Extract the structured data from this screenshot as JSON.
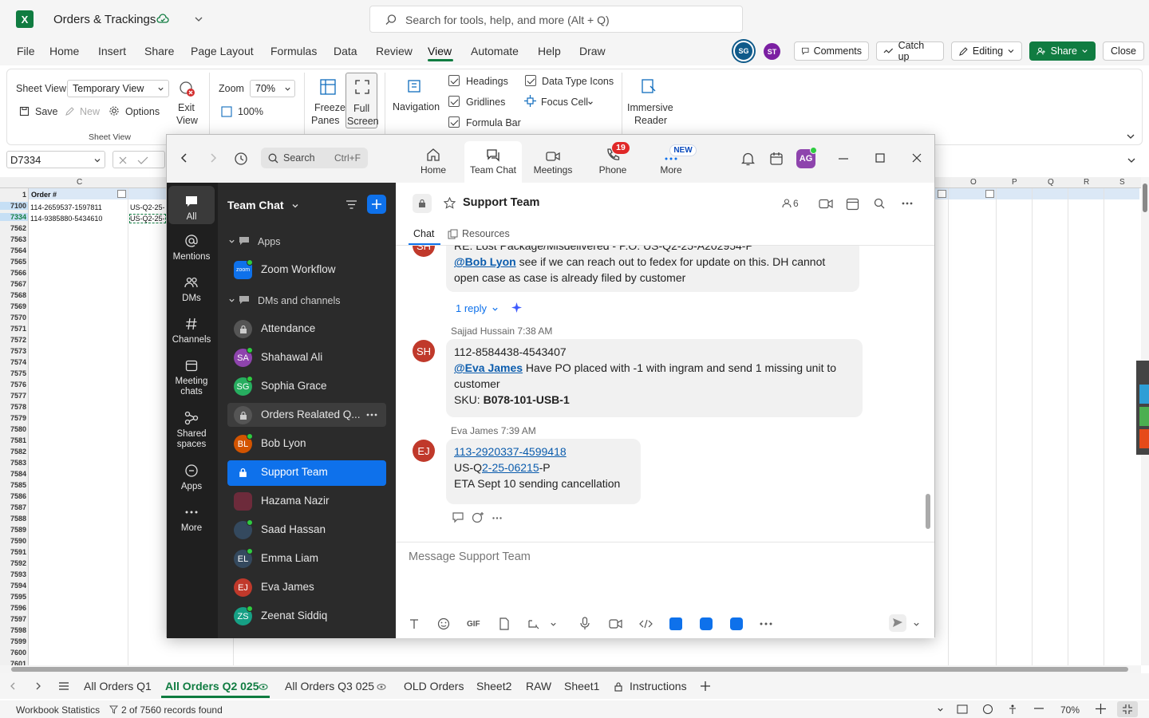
{
  "excel": {
    "title": "Orders & Trackings",
    "search_placeholder": "Search for tools, help, and more (Alt + Q)",
    "menu": [
      "File",
      "Home",
      "Insert",
      "Share",
      "Page Layout",
      "Formulas",
      "Data",
      "Review",
      "View",
      "Automate",
      "Help",
      "Draw"
    ],
    "active_menu": "View",
    "avatars": [
      "SG",
      "ST"
    ],
    "buttons": {
      "comments": "Comments",
      "catchup": "Catch up",
      "editing": "Editing",
      "share": "Share",
      "close": "Close"
    },
    "ribbon": {
      "sheet_view_label": "Sheet View",
      "sheet_view_value": "Temporary View",
      "save": "Save",
      "new": "New",
      "options": "Options",
      "exit_view_1": "Exit",
      "exit_view_2": "View",
      "group_sheet_view": "Sheet View",
      "zoom_label": "Zoom",
      "zoom_value": "70%",
      "zoom_100": "100%",
      "freeze_1": "Freeze",
      "freeze_2": "Panes",
      "full_1": "Full",
      "full_2": "Screen",
      "navigation": "Navigation",
      "headings": "Headings",
      "gridlines": "Gridlines",
      "formula_bar": "Formula Bar",
      "data_type_icons": "Data Type Icons",
      "focus_cell": "Focus Cell",
      "immersive_1": "Immersive",
      "immersive_2": "Reader"
    },
    "name_box": "D7334",
    "columns": [
      "C",
      "O",
      "P",
      "Q",
      "R",
      "S"
    ],
    "header_cell": "Order #",
    "rows": [
      {
        "n": "1",
        "a": "",
        "b": ""
      },
      {
        "n": "7100",
        "a": "114-2659537-1597811",
        "b": "US-Q2-25-"
      },
      {
        "n": "7334",
        "a": "114-9385880-5434610",
        "b": "US-Q2-25-"
      }
    ],
    "row_numbers": [
      "7562",
      "7563",
      "7564",
      "7565",
      "7566",
      "7567",
      "7568",
      "7569",
      "7570",
      "7571",
      "7572",
      "7573",
      "7574",
      "7575",
      "7576",
      "7577",
      "7578",
      "7579",
      "7580",
      "7581",
      "7582",
      "7583",
      "7584",
      "7585",
      "7586",
      "7587",
      "7588",
      "7589",
      "7590",
      "7591",
      "7592",
      "7593",
      "7594",
      "7595",
      "7596",
      "7597",
      "7598",
      "7599",
      "7600",
      "7601"
    ],
    "sheet_tabs": [
      "All Orders Q1",
      "All Orders Q2 025",
      "All Orders Q3 025",
      "OLD Orders",
      "Sheet2",
      "RAW",
      "Sheet1",
      "Instructions"
    ],
    "status_left": "Workbook Statistics",
    "status_filter": "2 of 7560 records found",
    "status_zoom": "70%"
  },
  "zoom": {
    "nav": {
      "search": "Search",
      "shortcut": "Ctrl+F"
    },
    "tabs": [
      {
        "label": "Home",
        "icon": "home-icon"
      },
      {
        "label": "Team Chat",
        "icon": "chat-icon"
      },
      {
        "label": "Meetings",
        "icon": "video-icon"
      },
      {
        "label": "Phone",
        "icon": "phone-icon"
      },
      {
        "label": "More",
        "icon": "more-icon"
      }
    ],
    "phone_badge": "19",
    "new_badge": "NEW",
    "user_avatar": "AG",
    "rail": [
      "All",
      "Mentions",
      "DMs",
      "Channels",
      "Meeting chats",
      "Shared spaces",
      "Apps",
      "More"
    ],
    "list_title": "Team Chat",
    "sections": {
      "apps": "Apps",
      "dms": "DMs and channels"
    },
    "items": [
      {
        "name": "Zoom Workflow",
        "initials": "zoom",
        "color": "#0e71eb"
      },
      {
        "name": "Attendance",
        "initials": "",
        "color": "#555"
      },
      {
        "name": "Shahawal Ali",
        "initials": "SA",
        "color": "#8e44ad"
      },
      {
        "name": "Sophia Grace",
        "initials": "SG",
        "color": "#27ae60"
      },
      {
        "name": "Orders Realated Q...",
        "initials": "",
        "color": "#555"
      },
      {
        "name": "Bob Lyon",
        "initials": "BL",
        "color": "#d35400"
      },
      {
        "name": "Support Team",
        "initials": "",
        "color": "#0e71eb"
      },
      {
        "name": "Hazama Nazir",
        "initials": "",
        "color": "#6d2b3b"
      },
      {
        "name": "Saad Hassan",
        "initials": "",
        "color": "#34495e"
      },
      {
        "name": "Emma Liam",
        "initials": "EL",
        "color": "#34495e"
      },
      {
        "name": "Eva James",
        "initials": "EJ",
        "color": "#c0392b"
      },
      {
        "name": "Zeenat Siddiq",
        "initials": "ZS",
        "color": "#16a085"
      }
    ],
    "channel": {
      "name": "Support Team",
      "members": "6",
      "tab_chat": "Chat",
      "tab_resources": "Resources"
    },
    "messages": {
      "m1_line0": "RE: Lost Package/Misdelivered - P.O: US-Q2-25-A202954-P",
      "m1_mention": "@Bob Lyon",
      "m1_text": " see if we can reach out to fedex for update on this. DH cannot open case as case is already filed by customer",
      "m1_reply": "1 reply",
      "m2_sender": "Sajjad Hussain",
      "m2_time": "7:38 AM",
      "m2_initials": "SH",
      "m2_line1": "112-8584438-4543407",
      "m2_mention": "@Eva James",
      "m2_text": " Have PO placed with -1 with ingram and send 1 missing unit to customer",
      "m2_sku_label": "SKU: ",
      "m2_sku": "B078-101-USB-1",
      "m3_sender": "Eva James",
      "m3_time": "7:39 AM",
      "m3_initials": "EJ",
      "m3_link": "113-2920337-4599418",
      "m3_po_a": "US-Q",
      "m3_po_b": "2-25-06215",
      "m3_po_c": "-P",
      "m3_line3": "ETA Sept 10 sending cancellation"
    },
    "composer_placeholder": "Message Support Team",
    "toolbar": {
      "gif": "GIF"
    }
  }
}
